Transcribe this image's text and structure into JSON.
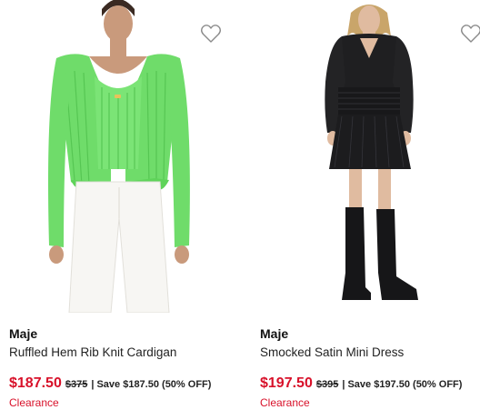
{
  "products": [
    {
      "brand": "Maje",
      "name": "Ruffled Hem Rib Knit Cardigan",
      "sale_price": "$187.50",
      "original_price": "$375",
      "save_text": "| Save $187.50 (50% OFF)",
      "badge": "Clearance",
      "wishlist_icon": "heart-outline-icon"
    },
    {
      "brand": "Maje",
      "name": "Smocked Satin Mini Dress",
      "sale_price": "$197.50",
      "original_price": "$395",
      "save_text": "| Save $197.50 (50% OFF)",
      "badge": "Clearance",
      "wishlist_icon": "heart-outline-icon"
    }
  ],
  "colors": {
    "sale": "#d8112a",
    "text": "#111111"
  }
}
